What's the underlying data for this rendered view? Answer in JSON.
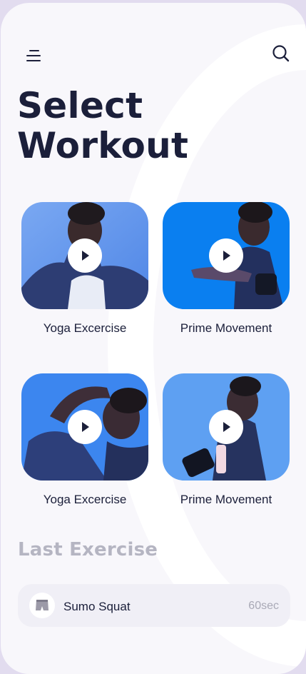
{
  "header": {
    "title_line1": "Select",
    "title_line2": "Workout"
  },
  "workouts": [
    {
      "label": "Yoga Excercise"
    },
    {
      "label": "Prime Movement"
    },
    {
      "label": "Yoga Excercise"
    },
    {
      "label": "Prime Movement"
    }
  ],
  "last_exercise": {
    "section_title": "Last Exercise",
    "name": "Sumo Squat",
    "duration": "60sec",
    "icon": "shorts-icon"
  },
  "colors": {
    "title": "#1b1f3a",
    "background": "#f8f7fb",
    "card_blue": "#3c88f4",
    "muted": "#b5b5c2"
  }
}
